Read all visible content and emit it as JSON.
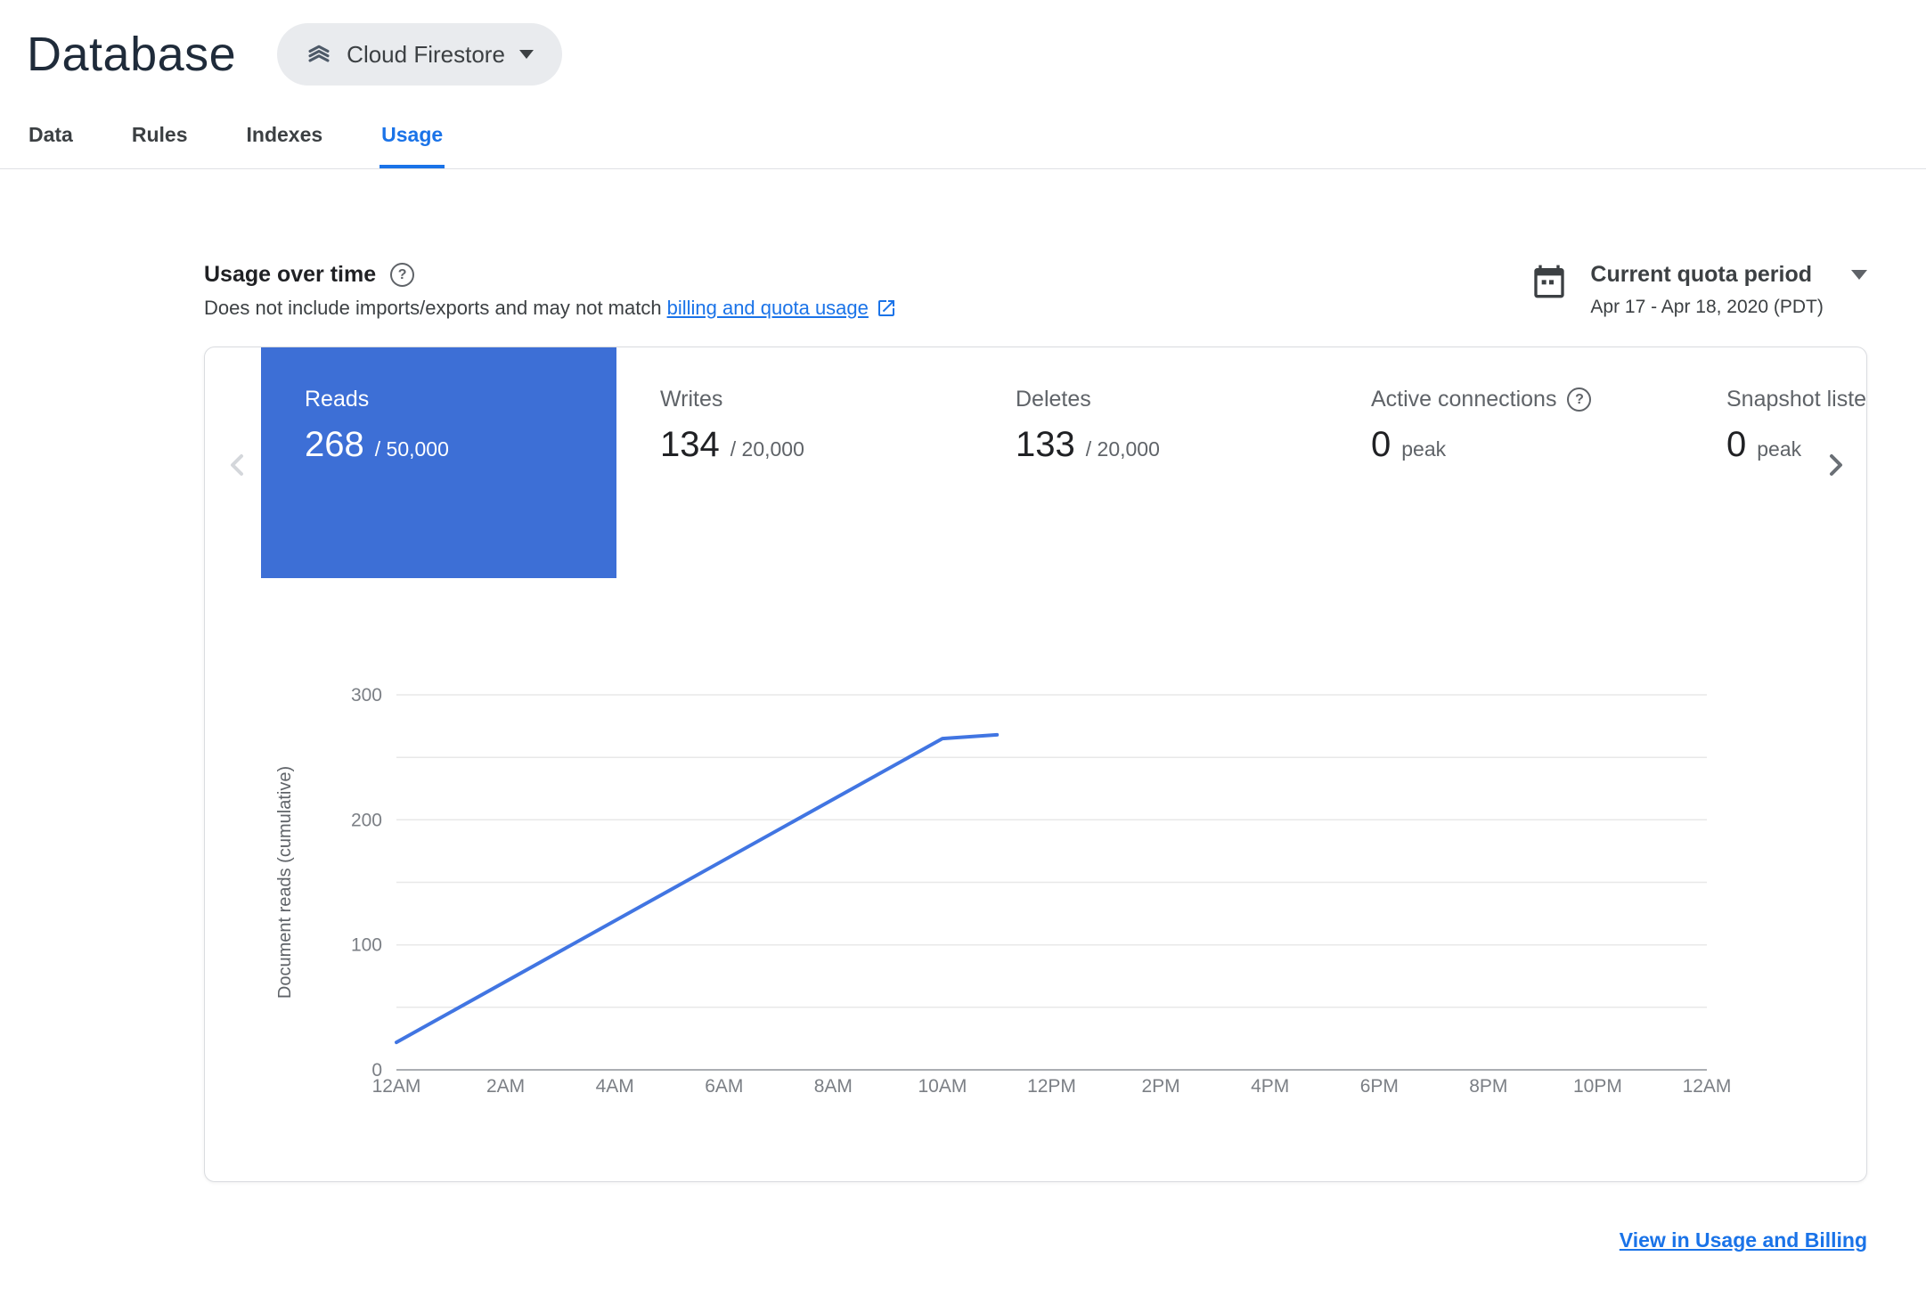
{
  "colors": {
    "accent_blue": "#1a73e8",
    "selected_metric_bg": "#3d6fd6"
  },
  "header": {
    "title": "Database",
    "product_selector": {
      "label": "Cloud Firestore"
    }
  },
  "tabs": [
    {
      "label": "Data",
      "active": false
    },
    {
      "label": "Rules",
      "active": false
    },
    {
      "label": "Indexes",
      "active": false
    },
    {
      "label": "Usage",
      "active": true
    }
  ],
  "usage_section": {
    "title": "Usage over time",
    "subtitle_prefix": "Does not include imports/exports and may not match",
    "subtitle_link": "billing and quota usage",
    "quota_period": {
      "label": "Current quota period",
      "range": "Apr 17 - Apr 18, 2020 (PDT)"
    }
  },
  "metrics": [
    {
      "label": "Reads",
      "value": "268",
      "limit": "/ 50,000",
      "selected": true
    },
    {
      "label": "Writes",
      "value": "134",
      "limit": "/ 20,000",
      "selected": false
    },
    {
      "label": "Deletes",
      "value": "133",
      "limit": "/ 20,000",
      "selected": false
    },
    {
      "label": "Active connections",
      "value": "0",
      "limit": "peak",
      "selected": false,
      "has_help": true
    },
    {
      "label": "Snapshot listeners",
      "value": "0",
      "limit": "peak",
      "selected": false
    }
  ],
  "chart_data": {
    "type": "line",
    "title": "",
    "xlabel": "",
    "ylabel": "Document reads (cumulative)",
    "x_ticks": [
      "12AM",
      "2AM",
      "4AM",
      "6AM",
      "8AM",
      "10AM",
      "12PM",
      "2PM",
      "4PM",
      "6PM",
      "8PM",
      "10PM",
      "12AM"
    ],
    "x_tick_step_hours": 2,
    "x_range_hours": [
      0,
      24
    ],
    "y_ticks": [
      0,
      100,
      200,
      300
    ],
    "ylim": [
      0,
      300
    ],
    "grid_step": 50,
    "grid": true,
    "legend": "none",
    "series": [
      {
        "name": "Document reads (cumulative)",
        "color": "#4175e2",
        "points": [
          {
            "hour": 0,
            "value": 22
          },
          {
            "hour": 10,
            "value": 265
          },
          {
            "hour": 11,
            "value": 268
          }
        ]
      }
    ]
  },
  "footer": {
    "link": "View in Usage and Billing"
  }
}
